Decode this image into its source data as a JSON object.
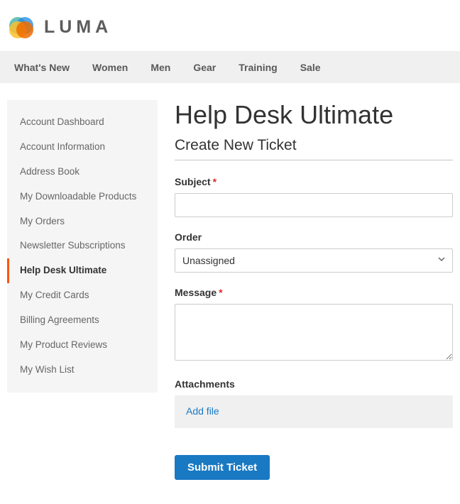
{
  "brand": "LUMA",
  "topnav": [
    {
      "label": "What's New"
    },
    {
      "label": "Women"
    },
    {
      "label": "Men"
    },
    {
      "label": "Gear"
    },
    {
      "label": "Training"
    },
    {
      "label": "Sale"
    }
  ],
  "sidebar": {
    "items": [
      {
        "label": "Account Dashboard",
        "active": false
      },
      {
        "label": "Account Information",
        "active": false
      },
      {
        "label": "Address Book",
        "active": false
      },
      {
        "label": "My Downloadable Products",
        "active": false
      },
      {
        "label": "My Orders",
        "active": false
      },
      {
        "label": "Newsletter Subscriptions",
        "active": false
      },
      {
        "label": "Help Desk Ultimate",
        "active": true
      },
      {
        "label": "My Credit Cards",
        "active": false
      },
      {
        "label": "Billing Agreements",
        "active": false
      },
      {
        "label": "My Product Reviews",
        "active": false
      },
      {
        "label": "My Wish List",
        "active": false
      }
    ]
  },
  "page": {
    "title": "Help Desk Ultimate",
    "subtitle": "Create New Ticket"
  },
  "form": {
    "subject": {
      "label": "Subject",
      "required": true,
      "value": ""
    },
    "order": {
      "label": "Order",
      "required": false,
      "selected": "Unassigned"
    },
    "message": {
      "label": "Message",
      "required": true,
      "value": ""
    },
    "attachments": {
      "label": "Attachments",
      "add_label": "Add file"
    },
    "submit_label": "Submit Ticket"
  },
  "colors": {
    "accent_orange": "#ff5501",
    "link_blue": "#1979c3",
    "required_red": "#e02b27"
  }
}
